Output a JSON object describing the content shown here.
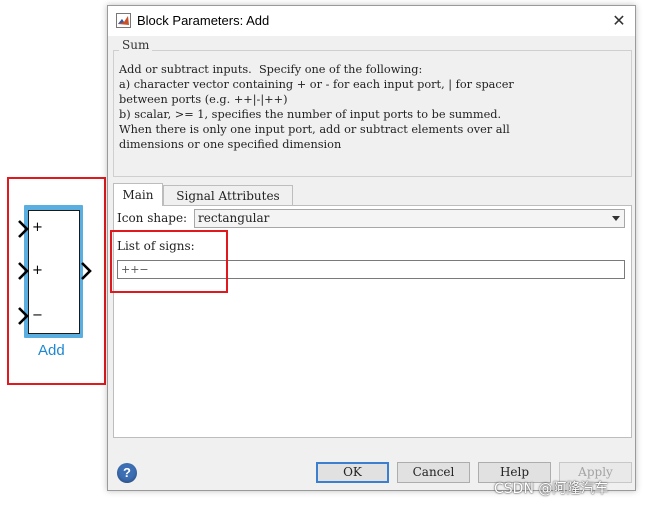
{
  "block": {
    "port_signs": [
      "+",
      "+",
      "−"
    ],
    "name": "Add",
    "colors": {
      "frame": "#5aaee0",
      "name": "#1e88d2",
      "highlight": "#e0191e"
    }
  },
  "dialog": {
    "title": "Block Parameters: Add",
    "close_glyph": "✕",
    "group_title": "Sum",
    "description": "Add or subtract inputs.  Specify one of the following:\na) character vector containing + or - for each input port, | for spacer\nbetween ports (e.g. ++|-|++)\nb) scalar, >= 1, specifies the number of input ports to be summed.\nWhen there is only one input port, add or subtract elements over all\ndimensions or one specified dimension",
    "tabs": [
      {
        "label": "Main",
        "active": true
      },
      {
        "label": "Signal Attributes",
        "active": false
      }
    ],
    "icon_shape": {
      "label": "Icon shape:",
      "value": "rectangular"
    },
    "list_of_signs": {
      "label": "List of signs:",
      "value": "++−"
    },
    "buttons": {
      "ok": "OK",
      "cancel": "Cancel",
      "help": "Help",
      "apply": "Apply"
    },
    "help_glyph": "?"
  },
  "watermark": "CSDN @阿隆汽车",
  "icons": [
    "matlab-icon",
    "close-icon",
    "dropdown-arrow-icon",
    "help-icon",
    "input-port-arrow-icon",
    "output-port-arrow-icon"
  ]
}
